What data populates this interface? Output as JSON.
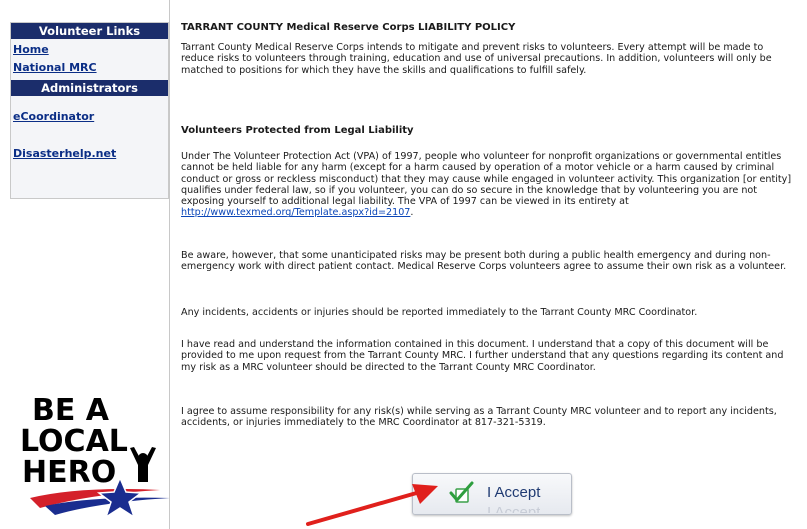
{
  "sidebar": {
    "volunteer_header": "Volunteer Links",
    "volunteer_links": [
      "Home",
      "National MRC"
    ],
    "admin_header": "Administrators",
    "admin_links": [
      "eCoordinator",
      "Disasterhelp.net"
    ]
  },
  "policy": {
    "title": "TARRANT COUNTY Medical Reserve Corps LIABILITY POLICY",
    "intro": "Tarrant County Medical Reserve Corps intends to mitigate and prevent risks to volunteers. Every attempt will be made to reduce risks to volunteers through training, education and use of universal precautions. In addition, volunteers will only be matched to positions for which they have the skills and qualifications to fulfill safely.",
    "legal_heading": "Volunteers Protected from Legal Liability",
    "legal_text": "Under The Volunteer Protection Act (VPA) of 1997, people who volunteer for nonprofit organizations or governmental entitles cannot be held liable for any harm (except for a harm caused by operation of a motor vehicle or a harm caused by criminal conduct or gross or reckless misconduct) that they may cause while engaged in volunteer activity. This organization [or entity] qualifies under federal law, so if you volunteer, you can do so secure in the knowledge that by volunteering you are not exposing yourself to additional legal liability. The VPA of 1997 can be viewed in its entirety at ",
    "legal_link": "http://www.texmed.org/Template.aspx?id=2107",
    "legal_end": ".",
    "risk_text": "Be aware, however, that some unanticipated risks may be present both during a public health emergency and during non-emergency work with direct patient contact. Medical Reserve Corps volunteers agree to assume their own risk as a volunteer.",
    "report_text": "Any incidents, accidents or injuries should be reported immediately to the Tarrant County MRC Coordinator.",
    "understand_text": "I have read and understand the information contained in this document. I understand that a copy of this document will be provided to me upon request from the Tarrant County MRC. I further understand that any questions regarding its content and my risk as a MRC volunteer should be directed to the Tarrant County MRC Coordinator.",
    "agree_text": "I agree to assume responsibility for any risk(s) while serving as a Tarrant County MRC volunteer and to report any incidents, accidents, or injuries immediately to the MRC Coordinator at 817-321-5319."
  },
  "hero_logo": {
    "line1": "BE A",
    "line2": "LOCAL",
    "line3": "HERO"
  },
  "accept_button": {
    "label": "I Accept"
  },
  "colors": {
    "sidebar_header": "#1b2d6b",
    "link": "#0b2e86",
    "arrow": "#e0201c"
  }
}
